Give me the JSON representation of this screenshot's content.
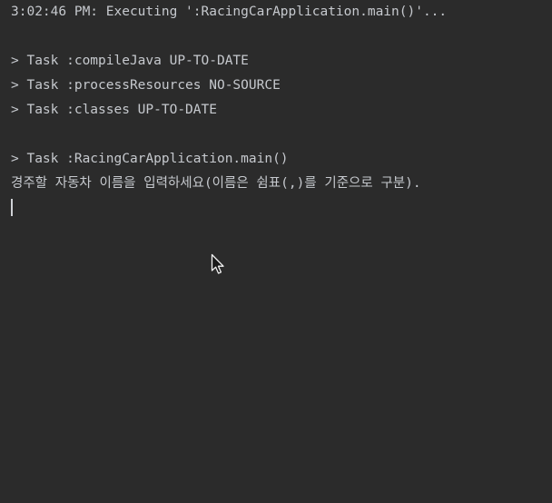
{
  "console": {
    "header": "3:02:46 PM: Executing ':RacingCarApplication.main()'...",
    "tasks": [
      "> Task :compileJava UP-TO-DATE",
      "> Task :processResources NO-SOURCE",
      "> Task :classes UP-TO-DATE"
    ],
    "main_task": "> Task :RacingCarApplication.main()",
    "prompt": "경주할 자동차 이름을 입력하세요(이름은 쉼표(,)를 기준으로 구분).",
    "input_value": ""
  },
  "colors": {
    "background": "#2b2b2b",
    "text": "#c6c9ce"
  },
  "icons": {
    "pointer": "mouse-pointer-icon"
  }
}
